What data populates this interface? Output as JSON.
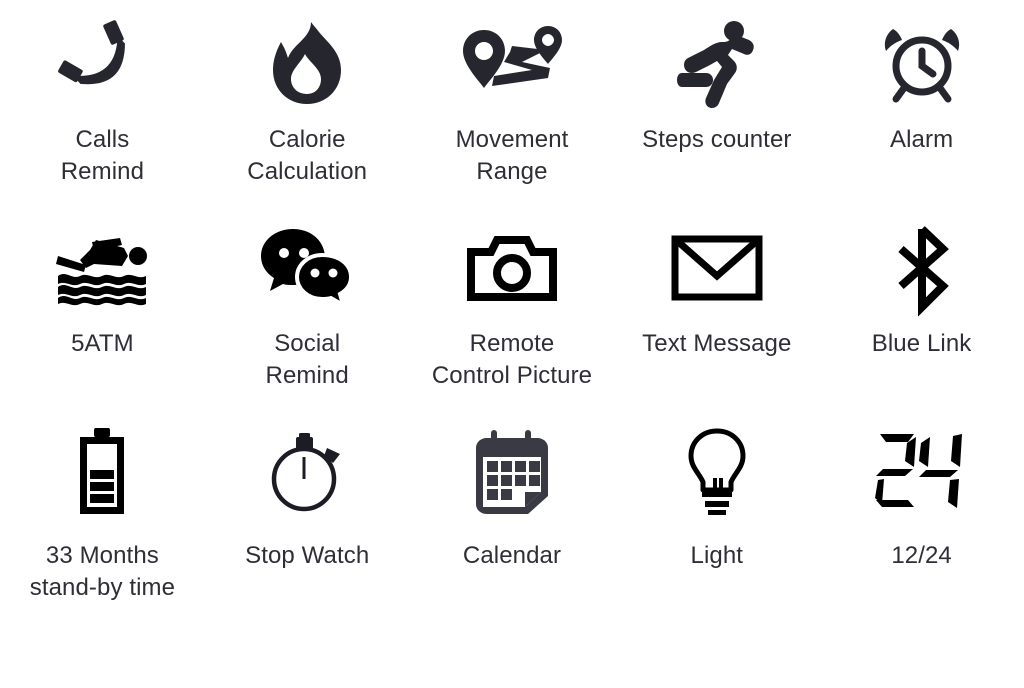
{
  "page": {
    "background_color": "#ffffff",
    "icon_color": "#1c1c24",
    "label_color": "#2e2e36",
    "columns": 5,
    "rows": 3
  },
  "features": [
    {
      "id": "calls-remind",
      "icon": "phone-handset-icon",
      "label": "Calls\nRemind"
    },
    {
      "id": "calorie",
      "icon": "flame-icon",
      "label": "Calorie\nCalculation"
    },
    {
      "id": "movement-range",
      "icon": "map-route-icon",
      "label": "Movement\nRange"
    },
    {
      "id": "steps-counter",
      "icon": "running-person-icon",
      "label": "Steps counter"
    },
    {
      "id": "alarm",
      "icon": "alarm-clock-icon",
      "label": "Alarm"
    },
    {
      "id": "water-resistance",
      "icon": "swimmer-waves-icon",
      "label": "5ATM"
    },
    {
      "id": "social-remind",
      "icon": "chat-bubbles-icon",
      "label": "Social\nRemind"
    },
    {
      "id": "remote-shutter",
      "icon": "camera-icon",
      "label": "Remote\nControl Picture"
    },
    {
      "id": "text-message",
      "icon": "envelope-icon",
      "label": "Text Message"
    },
    {
      "id": "blue-link",
      "icon": "bluetooth-icon",
      "label": "Blue Link"
    },
    {
      "id": "standby-time",
      "icon": "battery-icon",
      "label": "33 Months\nstand-by time"
    },
    {
      "id": "stop-watch",
      "icon": "stopwatch-icon",
      "label": "Stop Watch"
    },
    {
      "id": "calendar",
      "icon": "calendar-icon",
      "label": "Calendar"
    },
    {
      "id": "light",
      "icon": "light-bulb-icon",
      "label": "Light"
    },
    {
      "id": "time-format",
      "icon": "digital-24-icon",
      "label": "12/24"
    }
  ]
}
